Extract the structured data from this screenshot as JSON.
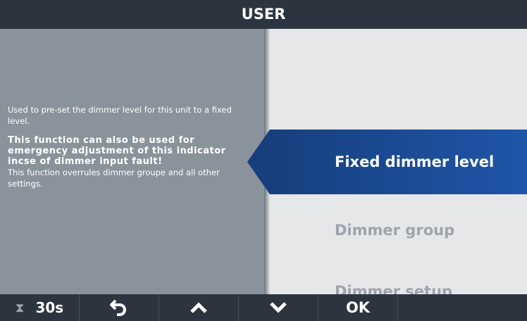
{
  "title": "USER",
  "help": {
    "line1": "Used to pre-set the dimmer level for this unit to a fixed level.",
    "bold": "This function can also be used for emergency adjustment of this indicator incse of dimmer input fault!",
    "line2": "This function overrules dimmer groupe and all other settings."
  },
  "menu": {
    "items": [
      {
        "label": "Fixed dimmer level",
        "selected": true
      },
      {
        "label": "Dimmer group",
        "selected": false
      },
      {
        "label": "Dimmer setup",
        "selected": false
      }
    ]
  },
  "footer": {
    "timer_icon": "hourglass-icon",
    "timer": "30s",
    "back_icon": "back-arrow-icon",
    "up_icon": "chevron-up-icon",
    "down_icon": "chevron-down-icon",
    "ok": "OK"
  },
  "colors": {
    "titlebar": "#2c353f",
    "help_panel": "#8a939b",
    "menu_bg": "#e6e7e9",
    "selected": "#1f56a8",
    "dim_text": "#9ea4ab"
  }
}
